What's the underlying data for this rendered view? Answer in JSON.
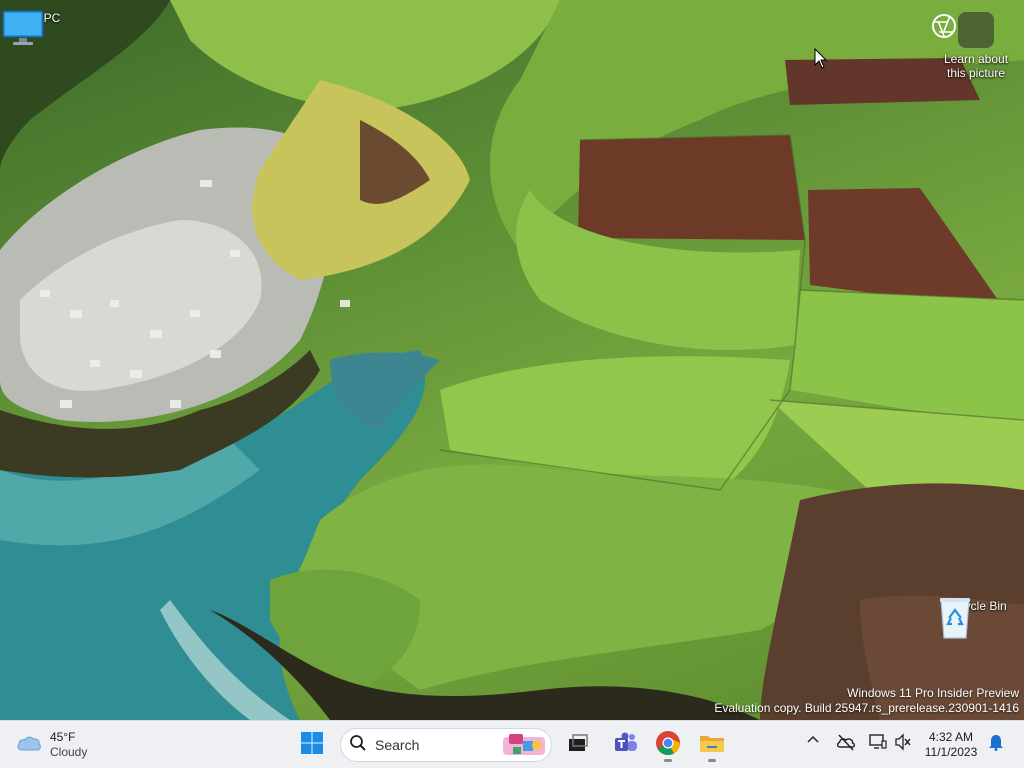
{
  "desktop": {
    "icons": [
      {
        "label": "This PC",
        "icon": "this-pc-icon"
      },
      {
        "label": "Recycle Bin",
        "icon": "recycle-bin-icon"
      }
    ],
    "spotlight": {
      "line1": "Learn about",
      "line2": "this picture",
      "icon": "camera-info-icon"
    },
    "watermark": {
      "line1": "Windows 11 Pro Insider Preview",
      "line2": "Evaluation copy. Build 25947.rs_prerelease.230901-1416"
    }
  },
  "taskbar": {
    "weather": {
      "temp": "45°F",
      "condition": "Cloudy",
      "icon": "cloud-icon"
    },
    "search": {
      "placeholder": "Search",
      "icon": "search-icon"
    },
    "apps": [
      {
        "name": "Start",
        "icon": "windows-logo-icon"
      },
      {
        "name": "Task View",
        "icon": "task-view-icon"
      },
      {
        "name": "Microsoft Teams",
        "icon": "teams-icon"
      },
      {
        "name": "Google Chrome",
        "icon": "chrome-icon"
      },
      {
        "name": "File Explorer",
        "icon": "folder-icon"
      }
    ],
    "tray": {
      "chevron_icon": "chevron-up-icon",
      "onedrive_icon": "onedrive-off-icon",
      "network_icon": "network-icon",
      "volume_icon": "volume-muted-icon",
      "time": "4:32 AM",
      "date": "11/1/2023",
      "notification_icon": "bell-icon"
    },
    "accent": "#0078d4"
  }
}
